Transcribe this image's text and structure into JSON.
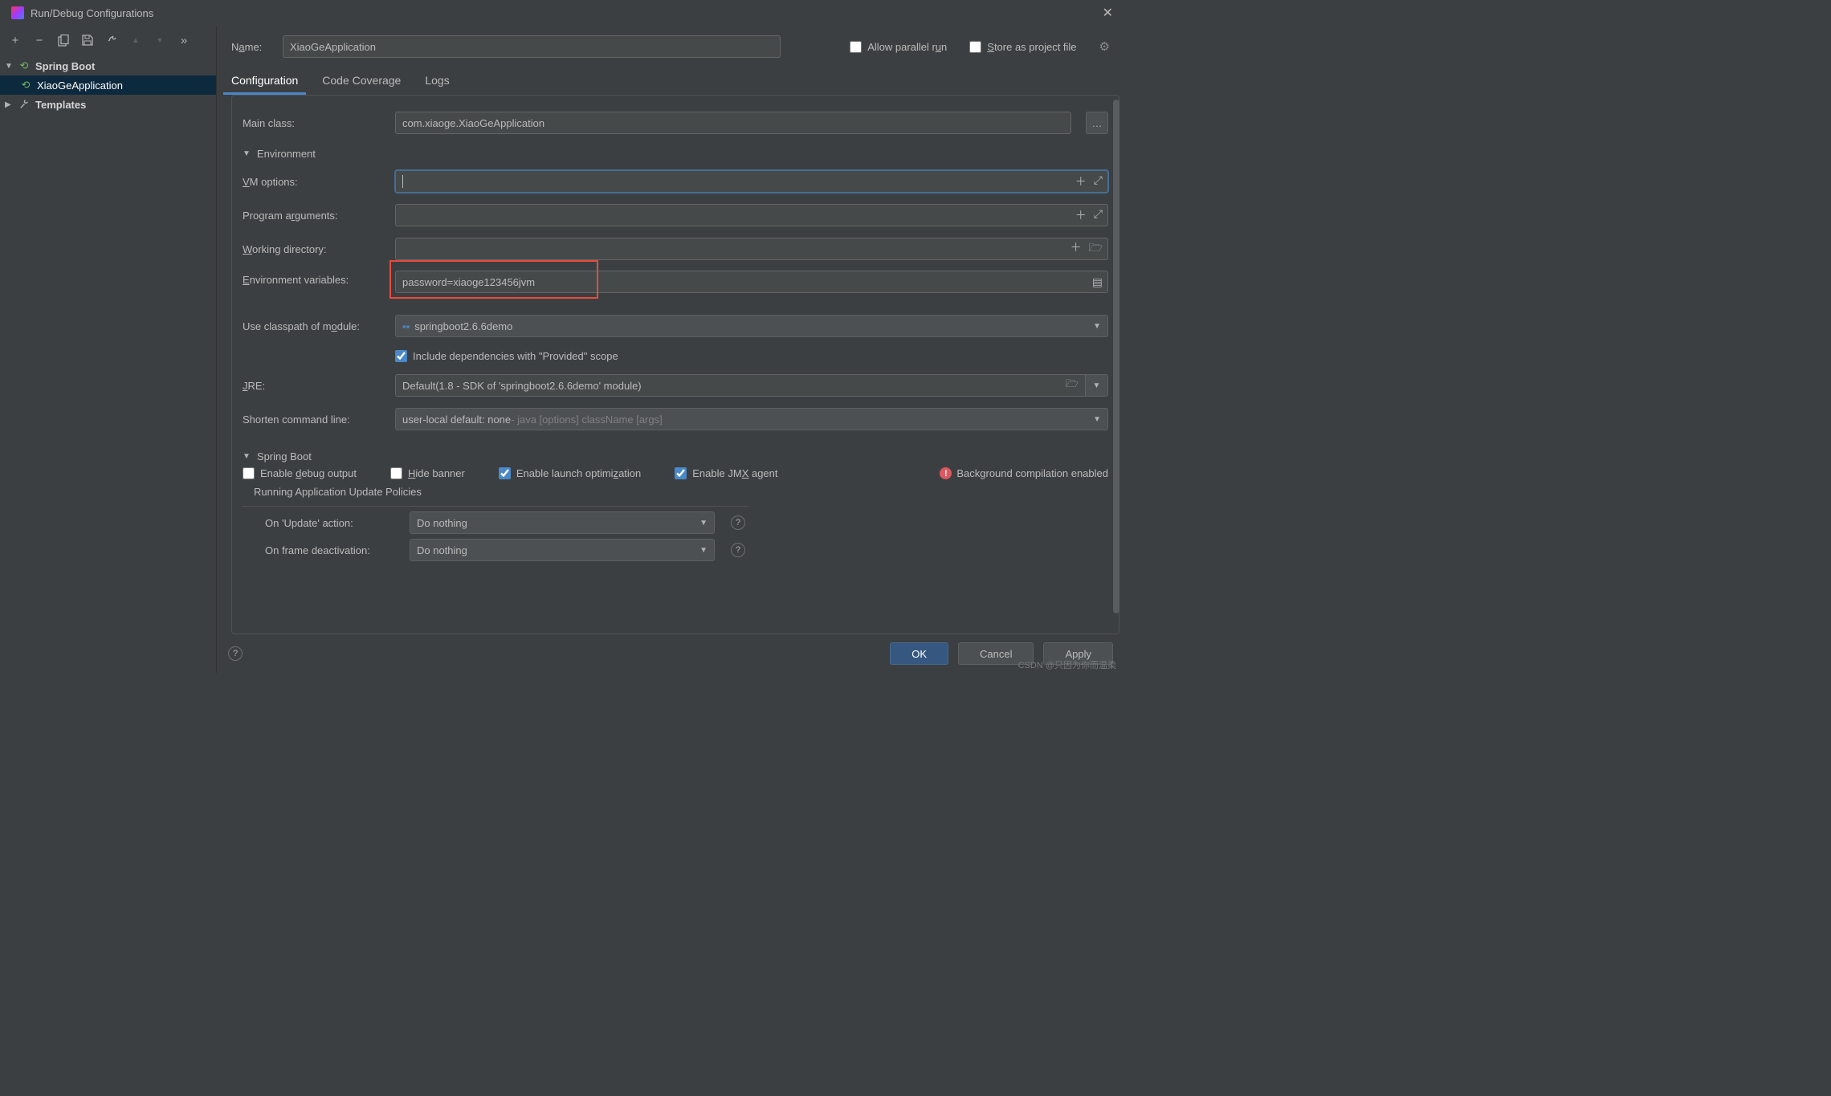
{
  "title": "Run/Debug Configurations",
  "sidebar": {
    "root": "Spring Boot",
    "item": "XiaoGeApplication",
    "templates": "Templates"
  },
  "toolbar": {
    "add": "+",
    "remove": "−",
    "copy": "⿻",
    "save": "💾",
    "wrench": "🔧",
    "up": "▲",
    "down": "▼",
    "more": "»"
  },
  "name": {
    "label_pre": "N",
    "label_u": "a",
    "label_post": "me:",
    "value": "XiaoGeApplication"
  },
  "topchecks": {
    "parallel_pre": "Allow parallel r",
    "parallel_u": "u",
    "parallel_post": "n",
    "store_u": "S",
    "store_post": "tore as project file"
  },
  "tabs": {
    "config": "Configuration",
    "coverage": "Code Coverage",
    "logs": "Logs"
  },
  "form": {
    "main_class_label": "Main class:",
    "main_class_value": "com.xiaoge.XiaoGeApplication",
    "env_section_pre": "Environ",
    "env_section_u": "m",
    "env_section_post": "ent",
    "vm_u": "V",
    "vm_post": "M options:",
    "args_pre": "Program a",
    "args_u": "r",
    "args_post": "guments:",
    "workdir_u": "W",
    "workdir_post": "orking directory:",
    "envvar_u": "E",
    "envvar_post": "nvironment variables:",
    "envvar_value": "password=xiaoge123456jvm",
    "classpath_pre": "Use classpath of m",
    "classpath_u": "o",
    "classpath_post": "dule:",
    "classpath_value": "springboot2.6.6demo",
    "include_provided": "Include dependencies with \"Provided\" scope",
    "jre_u": "J",
    "jre_post": "RE:",
    "jre_val": "Default",
    "jre_hint": " (1.8 - SDK of 'springboot2.6.6demo' module)",
    "shorten_label": "Shorten command line:",
    "shorten_val": "user-local default: none",
    "shorten_hint": " - java [options] className [args]",
    "sb_section": "Spring Boot",
    "enable_debug_pre": "Enable ",
    "enable_debug_u": "d",
    "enable_debug_post": "ebug output",
    "hide_u": "H",
    "hide_post": "ide banner",
    "launch_pre": "Enable launch optimi",
    "launch_u": "z",
    "launch_post": "ation",
    "jmx_pre": "Enable JM",
    "jmx_u": "X",
    "jmx_post": " agent",
    "bg_comp": "Background compilation enabled",
    "policies_head": "Running Application Update Policies",
    "on_update_pre": "On '",
    "on_update_u": "U",
    "on_update_post": "pdate' action:",
    "on_frame_pre": "On ",
    "on_frame_u": "f",
    "on_frame_post": "rame deactivation:",
    "do_nothing": "Do nothing"
  },
  "footer": {
    "ok": "OK",
    "cancel": "Cancel",
    "apply": "Apply"
  },
  "watermark": "CSDN @只因为你而温柔"
}
